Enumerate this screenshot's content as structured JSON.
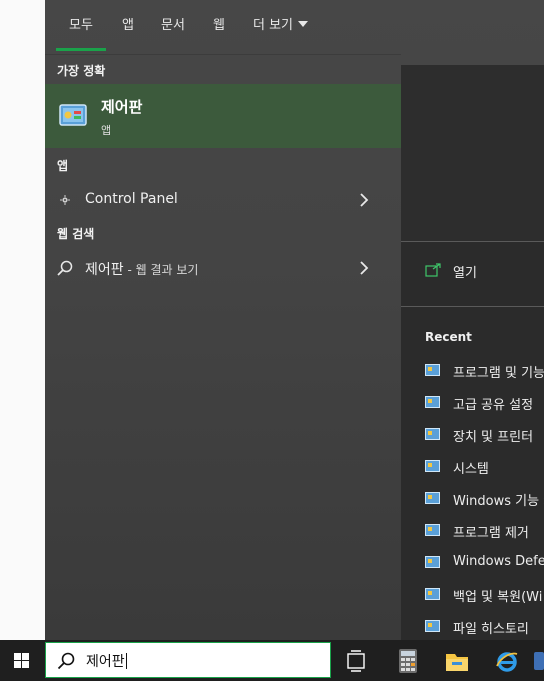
{
  "tabs": [
    {
      "label": "모두",
      "active": true
    },
    {
      "label": "앱"
    },
    {
      "label": "문서"
    },
    {
      "label": "웹"
    },
    {
      "label": "더 보기"
    }
  ],
  "best_match": {
    "heading": "가장 정확",
    "title": "제어판",
    "subtitle": "앱",
    "icon": "control-panel-icon"
  },
  "apps": {
    "heading": "앱",
    "items": [
      {
        "label": "Control Panel",
        "icon": "control-panel-small-icon"
      }
    ]
  },
  "web_search": {
    "heading": "웹 검색",
    "items": [
      {
        "label": "제어판",
        "suffix": " - 웹 결과 보기",
        "icon": "search-icon"
      }
    ]
  },
  "preview": {
    "open_label": "열기",
    "recent_heading": "Recent",
    "recent_items": [
      "프로그램 및 기능",
      "고급 공유 설정",
      "장치 및 프린터",
      "시스템",
      "Windows 기능 켜",
      "프로그램 제거",
      "Windows Defender",
      "백업 및 복원(Wi",
      "파일 히스토리"
    ]
  },
  "taskbar": {
    "search_value": "제어판",
    "icons": [
      "windows-start-icon",
      "task-view-icon",
      "calculator-icon",
      "file-explorer-icon",
      "internet-explorer-icon"
    ]
  },
  "colors": {
    "accent": "#1aa24a",
    "best_match_bg": "#3c5a3c",
    "panel_bg": "#444444",
    "taskbar_bg": "#1f1f1f"
  }
}
